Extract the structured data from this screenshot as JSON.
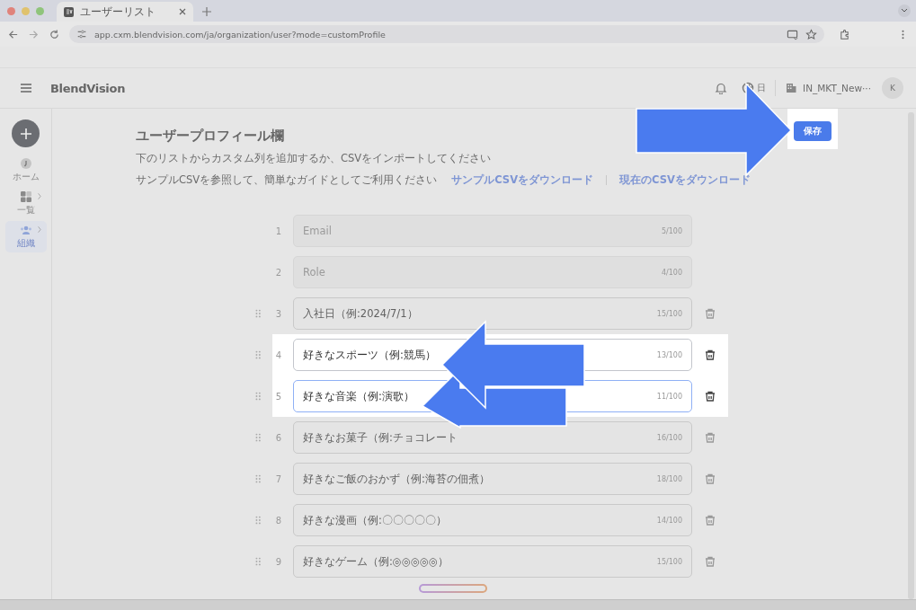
{
  "browser": {
    "tab_title": "ユーザーリスト",
    "url": "app.cxm.blendvision.com/ja/organization/user?mode=customProfile"
  },
  "header": {
    "logo": "BlendVision",
    "language": "日",
    "organization": "IN_MKT_New···",
    "avatar": "K"
  },
  "sidebar": {
    "items": [
      {
        "label": "ホーム",
        "kind": "home",
        "selected": false,
        "expandable": false
      },
      {
        "label": "一覧",
        "kind": "grid",
        "selected": false,
        "expandable": true
      },
      {
        "label": "組織",
        "kind": "people",
        "selected": true,
        "expandable": true
      }
    ]
  },
  "page": {
    "title": "ユーザープロフィール欄",
    "save_button": "保存",
    "save_highlighted": true,
    "description": "下のリストからカスタム列を追加するか、CSVをインポートしてください",
    "guide": "サンプルCSVを参照して、簡単なガイドとしてご利用ください",
    "links": [
      "サンプルCSVをダウンロード",
      "現在のCSVをダウンロード"
    ]
  },
  "fields": [
    {
      "number": "1",
      "value": "Email",
      "count": "5/100",
      "locked": true,
      "focused": false,
      "highlighted": false
    },
    {
      "number": "2",
      "value": "Role",
      "count": "4/100",
      "locked": true,
      "focused": false,
      "highlighted": false
    },
    {
      "number": "3",
      "value": "入社日（例:2024/7/1）",
      "count": "15/100",
      "locked": false,
      "focused": false,
      "highlighted": false
    },
    {
      "number": "4",
      "value": "好きなスポーツ（例:競馬）",
      "count": "13/100",
      "locked": false,
      "focused": false,
      "highlighted": true
    },
    {
      "number": "5",
      "value": "好きな音楽（例:演歌）",
      "count": "11/100",
      "locked": false,
      "focused": true,
      "highlighted": true
    },
    {
      "number": "6",
      "value": "好きなお菓子（例:チョコレート",
      "count": "16/100",
      "locked": false,
      "focused": false,
      "highlighted": false
    },
    {
      "number": "7",
      "value": "好きなご飯のおかず（例:海苔の佃煮）",
      "count": "18/100",
      "locked": false,
      "focused": false,
      "highlighted": false
    },
    {
      "number": "8",
      "value": "好きな漫画（例:〇〇〇〇〇）",
      "count": "14/100",
      "locked": false,
      "focused": false,
      "highlighted": false
    },
    {
      "number": "9",
      "value": "好きなゲーム（例:◎◎◎◎◎）",
      "count": "15/100",
      "locked": false,
      "focused": false,
      "highlighted": false
    }
  ],
  "annotations": [
    {
      "kind": "right-arrow"
    },
    {
      "kind": "left-arrow"
    },
    {
      "kind": "left-arrow"
    }
  ]
}
